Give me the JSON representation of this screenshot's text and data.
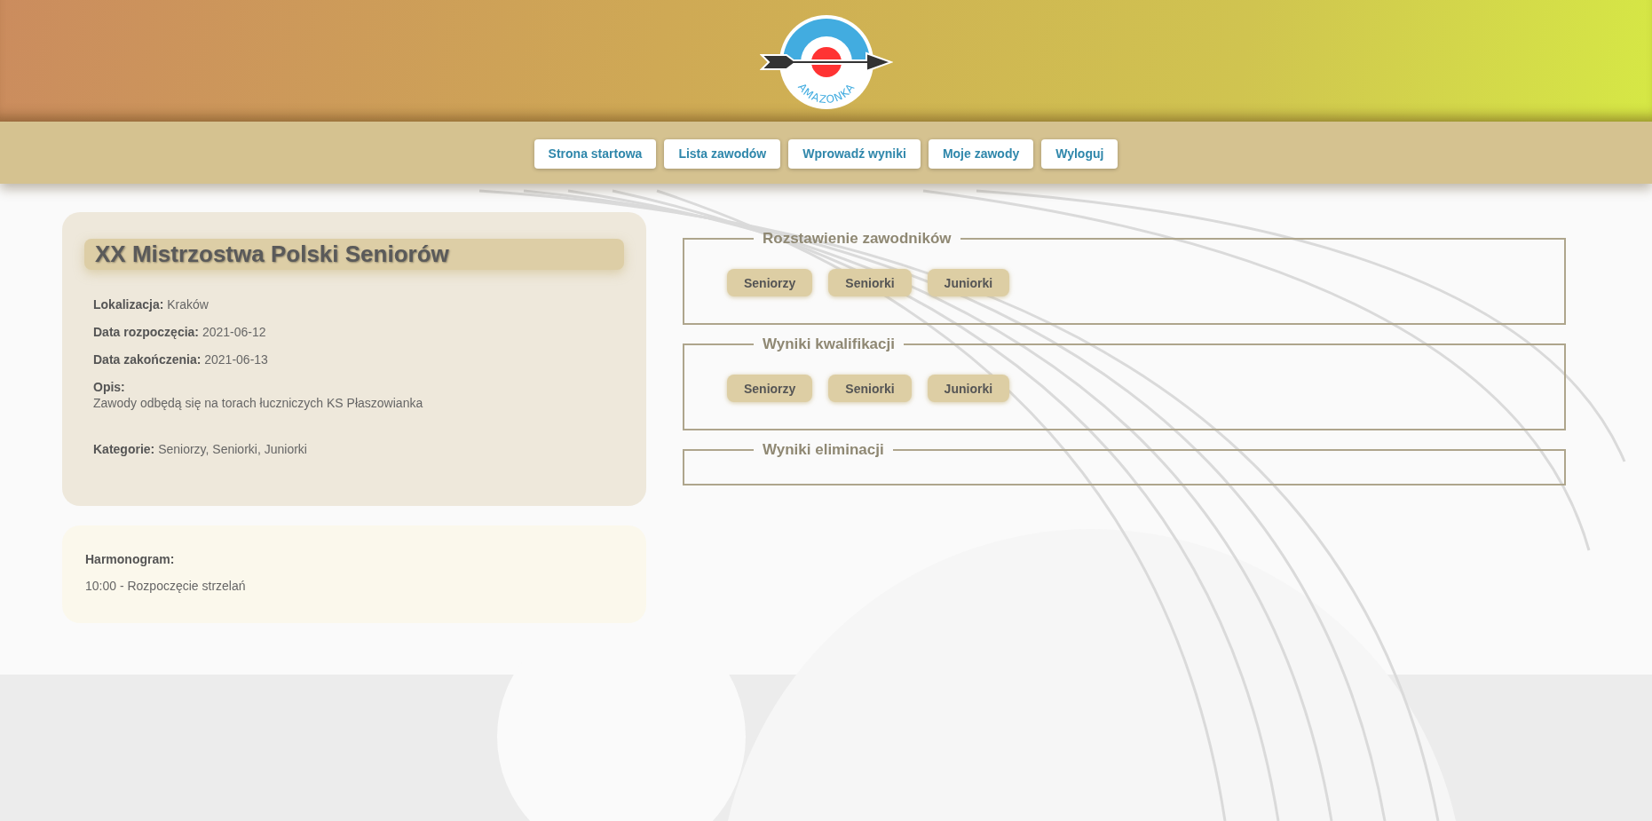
{
  "logo": {
    "text": "AMAZONKA"
  },
  "nav": [
    {
      "label": "Strona startowa"
    },
    {
      "label": "Lista zawodów"
    },
    {
      "label": "Wprowadź wyniki"
    },
    {
      "label": "Moje zawody"
    },
    {
      "label": "Wyloguj"
    }
  ],
  "competition": {
    "title": "XX Mistrzostwa Polski Seniorów",
    "fields": [
      {
        "label": "Lokalizacja:",
        "value": "Kraków",
        "kind": "inline"
      },
      {
        "label": "Data rozpoczęcia:",
        "value": "2021-06-12",
        "kind": "inline"
      },
      {
        "label": "Data zakończenia:",
        "value": "2021-06-13",
        "kind": "inline"
      },
      {
        "label": "Opis:",
        "value": "Zawody odbędą się na torach łuczniczych KS Płaszowianka",
        "kind": "block"
      },
      {
        "label": "Kategorie:",
        "value": "Seniorzy, Seniorki, Juniorki",
        "kind": "inline"
      }
    ]
  },
  "schedule": {
    "title": "Harmonogram:",
    "items": [
      "10:00 - Rozpoczęcie strzelań"
    ]
  },
  "sections": [
    {
      "title": "Rozstawienie zawodników",
      "buttons": [
        "Seniorzy",
        "Seniorki",
        "Juniorki"
      ]
    },
    {
      "title": "Wyniki kwalifikacji",
      "buttons": [
        "Seniorzy",
        "Seniorki",
        "Juniorki"
      ]
    },
    {
      "title": "Wyniki eliminacji"
    }
  ]
}
